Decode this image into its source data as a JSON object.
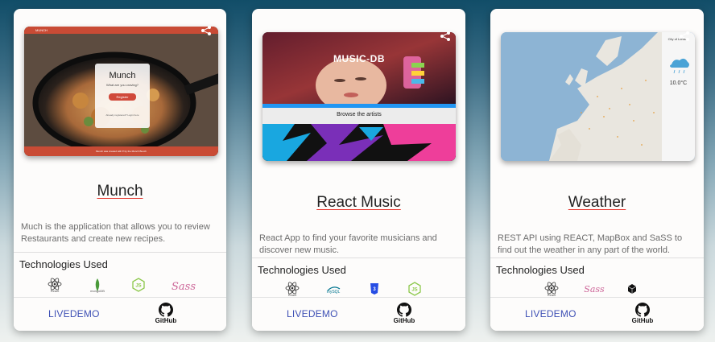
{
  "projects": [
    {
      "title": "Munch",
      "description": "Much is the application that allows you to review Restaurants and create new recipes.",
      "tech_heading": "Technologies Used",
      "technologies": [
        {
          "name": "React",
          "icon": "react-icon",
          "color": "#333333"
        },
        {
          "name": "mongoDB",
          "icon": "mongodb-icon",
          "color": "#4a9a3a"
        },
        {
          "name": "Node.js",
          "icon": "nodejs-icon",
          "color": "#8cc84b"
        },
        {
          "name": "Sass",
          "icon": "sass-icon",
          "color": "#cd6799"
        }
      ],
      "livedemo_label": "LIVEDEMO",
      "github_label": "GitHub",
      "screenshot": {
        "appbar_title": "MUNCH",
        "heading": "Munch",
        "prompt": "What are you craving?",
        "button_label": "Register",
        "link_text": "Already registered? Login here",
        "footer_text": "Munch was created with ♥ by the Munch Bunch",
        "accent_color": "#c94b35"
      }
    },
    {
      "title": "React Music",
      "description": "React App to find your favorite musicians and discover new music.",
      "tech_heading": "Technologies Used",
      "technologies": [
        {
          "name": "React",
          "icon": "react-icon",
          "color": "#333333"
        },
        {
          "name": "mySQL",
          "icon": "mysql-icon",
          "color": "#00758f"
        },
        {
          "name": "CSS3",
          "icon": "css3-icon",
          "color": "#264de4"
        },
        {
          "name": "Node.js",
          "icon": "nodejs-icon",
          "color": "#8cc84b"
        }
      ],
      "livedemo_label": "LIVEDEMO",
      "github_label": "GitHub",
      "screenshot": {
        "logo_text": "MUSIC-DB",
        "browse_label": "Browse the artists",
        "accent_color": "#2196f3"
      }
    },
    {
      "title": "Weather",
      "description": "REST API using REACT, MapBox and SaSS to find out the weather in any part of the world.",
      "tech_heading": "Technologies Used",
      "technologies": [
        {
          "name": "React",
          "icon": "react-icon",
          "color": "#333333"
        },
        {
          "name": "Sass",
          "icon": "sass-icon",
          "color": "#cd6799"
        },
        {
          "name": "CodeSandbox",
          "icon": "cube-icon",
          "color": "#111111"
        }
      ],
      "livedemo_label": "LIVEDEMO",
      "github_label": "GitHub",
      "screenshot": {
        "city": "City of London",
        "temperature": "10.0°C",
        "map_water_color": "#8db4d4",
        "map_land_color": "#e9e6df"
      }
    }
  ]
}
